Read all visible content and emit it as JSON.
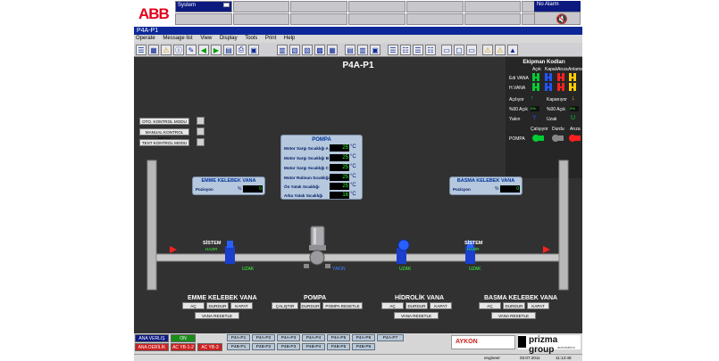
{
  "header": {
    "logo": "ABB",
    "system_label": "System",
    "system_value": "",
    "alarm_label": "No Alarm"
  },
  "window": {
    "title": "P4A-P1"
  },
  "menu": [
    "Operate",
    "Message list",
    "View",
    "Display",
    "Tools",
    "Print",
    "Help"
  ],
  "page": {
    "title": "P4A-P1"
  },
  "legend": {
    "title": "Ekipman Kodları",
    "cols": [
      "Açık",
      "Kapalı",
      "Arıza",
      "Anlamsız"
    ],
    "rows": [
      "Edi VANA",
      "H.VANA"
    ],
    "apkeys": [
      {
        "label": "Açılıyor",
        "val": "Kapanıyor"
      },
      {
        "label": "%00 Açık",
        "val": "%00 Açık"
      },
      {
        "label": "Yakın",
        "val": "Uzak"
      }
    ],
    "pump_cols": [
      "Çalışıyor",
      "Durdu",
      "Arıza"
    ],
    "pump_label": "POMPA"
  },
  "modes": [
    "OTO. KONTROL MODU",
    "MANUAL KONTROL MODU",
    "TEST KONTROL MODU"
  ],
  "pompa_panel": {
    "title": "POMPA",
    "unit": "°C",
    "rows": [
      {
        "label": "Motor Sargı Sıcaklığı A",
        "value": "25"
      },
      {
        "label": "Motor Sargı Sıcaklığı B",
        "value": "25"
      },
      {
        "label": "Motor Sargı Sıcaklığı C",
        "value": "25"
      },
      {
        "label": "Motor Rulman Sıcaklığı",
        "value": "25"
      },
      {
        "label": "Ön Yatak Sıcaklığı",
        "value": "25"
      },
      {
        "label": "Arka Yatak Sıcaklığı",
        "value": "16"
      }
    ]
  },
  "emme_panel": {
    "title": "EMME KELEBEK VANA",
    "label": "Pozisyon",
    "pct": "%",
    "value": "0"
  },
  "basma_panel": {
    "title": "BASMA KELEBEK VANA",
    "label": "Pozisyon",
    "pct": "%",
    "value": "0"
  },
  "process": {
    "left_sistem": "SİSTEM",
    "left_hazir": "HAZIR",
    "right_sistem": "SİSTEM",
    "right_hazir": "HAZIR",
    "uzak1": "UZAK",
    "yakin": "YAKIN",
    "uzak2": "UZAK",
    "uzak3": "UZAK"
  },
  "groups": [
    {
      "title": "EMME KELEBEK VANA",
      "buttons": [
        "AÇ",
        "DURDUR",
        "KAPAT"
      ],
      "reset": "VANA RESETLE"
    },
    {
      "title": "POMPA",
      "buttons": [
        "ÇALIŞTIR",
        "DURDUR",
        "POMPA RESETLE"
      ],
      "reset": ""
    },
    {
      "title": "HİDROLİK VANA",
      "buttons": [
        "AÇ",
        "DURDUR",
        "KAPAT"
      ],
      "reset": "VANA RESETLE"
    },
    {
      "title": "BASMA KELEBEK VANA",
      "buttons": [
        "AÇ",
        "DURDUR",
        "KAPAT"
      ],
      "reset": "VANA RESETLE"
    }
  ],
  "bottom": {
    "ana": "ANA VERLIŞ",
    "ana_val": "ON",
    "ana2": "ANA DERİLİK",
    "ac1": "AC YB-1-2",
    "ac2": "AC YB-3",
    "nav_row1": [
      "P4A-P1",
      "P4A-P2",
      "P4A-P3",
      "P4A-P4",
      "P4A-P5",
      "P4A-P6",
      "P4A-P7"
    ],
    "nav_row2": [
      "P4B-P1",
      "P4B-P2",
      "P4B-P3",
      "P4B-P4",
      "P4B-P5",
      "P4B-P6"
    ],
    "aykon": "AYKON",
    "prizma": "prizma group",
    "prizma_sub": "automation",
    "status_user": "engineer",
    "status_date": "03.07.2011",
    "status_time": "11:12:48"
  }
}
